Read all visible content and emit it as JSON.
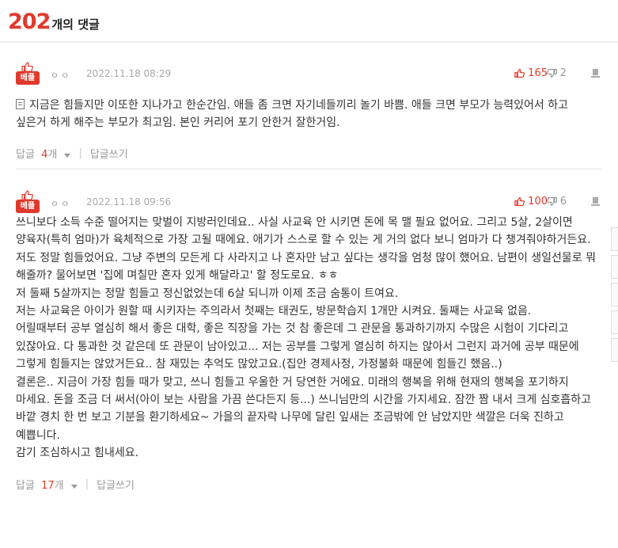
{
  "header": {
    "count": "202",
    "label": "개의 댓글"
  },
  "comments": [
    {
      "best_label": "베플",
      "author": "ㅇㅇ",
      "date": "2022.11.18 08:29",
      "likes": "165",
      "dislikes": "2",
      "body": "지금은 힘들지만 이또한 지나가고 한순간임. 애들 좀 크면 자기네들끼리 놀기 바쁨. 애들 크면 부모가 능력있어서 하고 싶은거 하게 해주는 부모가 최고임. 본인 커리어 포기 안한거 잘한거임.",
      "reply_label": "답글",
      "reply_count": "4",
      "reply_unit": "개",
      "write_reply": "답글쓰기"
    },
    {
      "best_label": "베플",
      "author": "ㅇㅇ",
      "date": "2022.11.18 09:56",
      "likes": "100",
      "dislikes": "6",
      "body_lines": [
        "쓰니보다 소득 수준 떨어지는 맞벌이 지방러인데요.. 사실 사교육 안 시키면 돈에 목 맬 필요 없어요. 그리고 5살, 2살이면 양육자(특히 엄마)가 육체적으로 가장 고될 때에요. 애기가 스스로 할 수 있는 게 거의 없다 보니 엄마가 다 챙겨줘야하거든요.",
        "저도 정말 힘들었어요. 그냥 주변의 모든게 다 사라지고 나 혼자만 남고 싶다는 생각을 엄청 많이 했어요. 남편이 생일선물로 뭐 해줄까? 물어보면 '집에 며칠만 혼자 있게 해달라고' 할 정도로요. ㅎㅎ",
        "저 둘째 5살까지는 정말 힘들고 정신없었는데 6살 되니까 이제 조금 숨통이 트여요.",
        "저는 사교육은 아이가 원할 때 시키자는 주의라서 첫째는 태권도, 방문학습지 1개만 시켜요. 둘째는 사교육 없음.",
        "어릴때부터 공부 열심히 해서 좋은 대학, 좋은 직장을 가는 것 참 좋은데 그 관문을 통과하기까지 수많은 시험이 기다리고 있잖아요. 다 통과한 것 같은데 또 관문이 남아있고... 저는 공부를 그렇게 열심히 하지는 않아서 그런지 과거에 공부 때문에 그렇게 힘들지는 않았거든요.. 참 재밌는 추억도 많았고요.(집안 경제사정, 가정불화 때문에 힘들긴 했음..)",
        "결론은.. 지금이 가장 힘들 때가 맞고, 쓰니 힘들고 우울한 거 당연한 거에요. 미래의 행복을 위해 현재의 행복을 포기하지 마세요. 돈을 조금 더 써서(아이 보는 사람을 가끔 쓴다든지 등...) 쓰니님만의 시간을 가지세요. 잠깐 짬 내서 크게 심호흡하고 바깥 경치 한 번 보고 기분을 환기하세요~ 가을의 끝자락 나무에 달린 잎새는 조금밖에 안 남았지만 색깔은 더욱 진하고 예쁩니다.",
        "감기 조심하시고 힘내세요."
      ],
      "reply_label": "답글",
      "reply_count": "17",
      "reply_unit": "개",
      "write_reply": "답글쓰기"
    }
  ],
  "colors": {
    "accent": "#e0392b",
    "muted": "#999999"
  }
}
